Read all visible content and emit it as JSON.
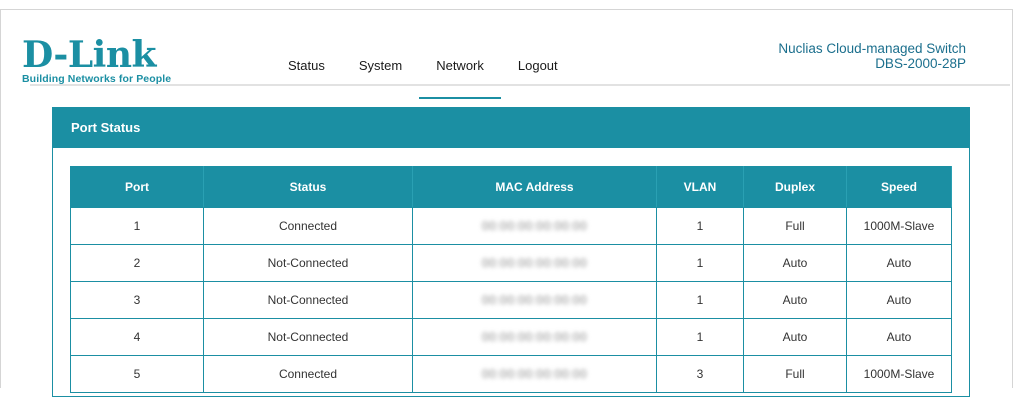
{
  "logo": {
    "name": "D-Link",
    "tagline": "Building Networks for People"
  },
  "nav": [
    "Status",
    "System",
    "Network",
    "Logout"
  ],
  "brand": {
    "line1": "Nuclias Cloud-managed Switch",
    "line2": "DBS-2000-28P"
  },
  "panel": {
    "title": "Port Status"
  },
  "table": {
    "headers": [
      "Port",
      "Status",
      "MAC Address",
      "VLAN",
      "Duplex",
      "Speed"
    ],
    "rows": [
      {
        "port": "1",
        "status": "Connected",
        "mac": "00:00:00:00:00:00",
        "vlan": "1",
        "duplex": "Full",
        "speed": "1000M-Slave"
      },
      {
        "port": "2",
        "status": "Not-Connected",
        "mac": "00:00:00:00:00:00",
        "vlan": "1",
        "duplex": "Auto",
        "speed": "Auto"
      },
      {
        "port": "3",
        "status": "Not-Connected",
        "mac": "00:00:00:00:00:00",
        "vlan": "1",
        "duplex": "Auto",
        "speed": "Auto"
      },
      {
        "port": "4",
        "status": "Not-Connected",
        "mac": "00:00:00:00:00:00",
        "vlan": "1",
        "duplex": "Auto",
        "speed": "Auto"
      },
      {
        "port": "5",
        "status": "Connected",
        "mac": "00:00:00:00:00:00",
        "vlan": "3",
        "duplex": "Full",
        "speed": "1000M-Slave"
      }
    ]
  },
  "colors": {
    "accent": "#1b8fa3",
    "brand_text": "#1b6f8d"
  }
}
